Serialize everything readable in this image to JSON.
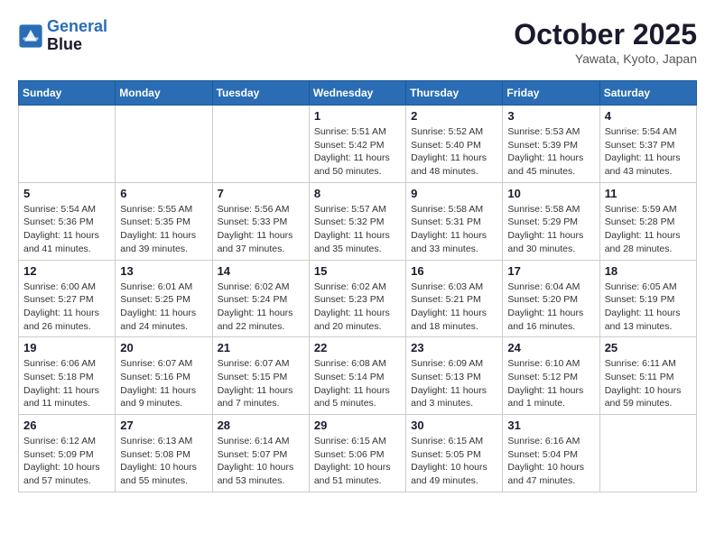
{
  "header": {
    "logo_line1": "General",
    "logo_line2": "Blue",
    "month_title": "October 2025",
    "location": "Yawata, Kyoto, Japan"
  },
  "days_of_week": [
    "Sunday",
    "Monday",
    "Tuesday",
    "Wednesday",
    "Thursday",
    "Friday",
    "Saturday"
  ],
  "weeks": [
    [
      {
        "day": "",
        "info": ""
      },
      {
        "day": "",
        "info": ""
      },
      {
        "day": "",
        "info": ""
      },
      {
        "day": "1",
        "info": "Sunrise: 5:51 AM\nSunset: 5:42 PM\nDaylight: 11 hours\nand 50 minutes."
      },
      {
        "day": "2",
        "info": "Sunrise: 5:52 AM\nSunset: 5:40 PM\nDaylight: 11 hours\nand 48 minutes."
      },
      {
        "day": "3",
        "info": "Sunrise: 5:53 AM\nSunset: 5:39 PM\nDaylight: 11 hours\nand 45 minutes."
      },
      {
        "day": "4",
        "info": "Sunrise: 5:54 AM\nSunset: 5:37 PM\nDaylight: 11 hours\nand 43 minutes."
      }
    ],
    [
      {
        "day": "5",
        "info": "Sunrise: 5:54 AM\nSunset: 5:36 PM\nDaylight: 11 hours\nand 41 minutes."
      },
      {
        "day": "6",
        "info": "Sunrise: 5:55 AM\nSunset: 5:35 PM\nDaylight: 11 hours\nand 39 minutes."
      },
      {
        "day": "7",
        "info": "Sunrise: 5:56 AM\nSunset: 5:33 PM\nDaylight: 11 hours\nand 37 minutes."
      },
      {
        "day": "8",
        "info": "Sunrise: 5:57 AM\nSunset: 5:32 PM\nDaylight: 11 hours\nand 35 minutes."
      },
      {
        "day": "9",
        "info": "Sunrise: 5:58 AM\nSunset: 5:31 PM\nDaylight: 11 hours\nand 33 minutes."
      },
      {
        "day": "10",
        "info": "Sunrise: 5:58 AM\nSunset: 5:29 PM\nDaylight: 11 hours\nand 30 minutes."
      },
      {
        "day": "11",
        "info": "Sunrise: 5:59 AM\nSunset: 5:28 PM\nDaylight: 11 hours\nand 28 minutes."
      }
    ],
    [
      {
        "day": "12",
        "info": "Sunrise: 6:00 AM\nSunset: 5:27 PM\nDaylight: 11 hours\nand 26 minutes."
      },
      {
        "day": "13",
        "info": "Sunrise: 6:01 AM\nSunset: 5:25 PM\nDaylight: 11 hours\nand 24 minutes."
      },
      {
        "day": "14",
        "info": "Sunrise: 6:02 AM\nSunset: 5:24 PM\nDaylight: 11 hours\nand 22 minutes."
      },
      {
        "day": "15",
        "info": "Sunrise: 6:02 AM\nSunset: 5:23 PM\nDaylight: 11 hours\nand 20 minutes."
      },
      {
        "day": "16",
        "info": "Sunrise: 6:03 AM\nSunset: 5:21 PM\nDaylight: 11 hours\nand 18 minutes."
      },
      {
        "day": "17",
        "info": "Sunrise: 6:04 AM\nSunset: 5:20 PM\nDaylight: 11 hours\nand 16 minutes."
      },
      {
        "day": "18",
        "info": "Sunrise: 6:05 AM\nSunset: 5:19 PM\nDaylight: 11 hours\nand 13 minutes."
      }
    ],
    [
      {
        "day": "19",
        "info": "Sunrise: 6:06 AM\nSunset: 5:18 PM\nDaylight: 11 hours\nand 11 minutes."
      },
      {
        "day": "20",
        "info": "Sunrise: 6:07 AM\nSunset: 5:16 PM\nDaylight: 11 hours\nand 9 minutes."
      },
      {
        "day": "21",
        "info": "Sunrise: 6:07 AM\nSunset: 5:15 PM\nDaylight: 11 hours\nand 7 minutes."
      },
      {
        "day": "22",
        "info": "Sunrise: 6:08 AM\nSunset: 5:14 PM\nDaylight: 11 hours\nand 5 minutes."
      },
      {
        "day": "23",
        "info": "Sunrise: 6:09 AM\nSunset: 5:13 PM\nDaylight: 11 hours\nand 3 minutes."
      },
      {
        "day": "24",
        "info": "Sunrise: 6:10 AM\nSunset: 5:12 PM\nDaylight: 11 hours\nand 1 minute."
      },
      {
        "day": "25",
        "info": "Sunrise: 6:11 AM\nSunset: 5:11 PM\nDaylight: 10 hours\nand 59 minutes."
      }
    ],
    [
      {
        "day": "26",
        "info": "Sunrise: 6:12 AM\nSunset: 5:09 PM\nDaylight: 10 hours\nand 57 minutes."
      },
      {
        "day": "27",
        "info": "Sunrise: 6:13 AM\nSunset: 5:08 PM\nDaylight: 10 hours\nand 55 minutes."
      },
      {
        "day": "28",
        "info": "Sunrise: 6:14 AM\nSunset: 5:07 PM\nDaylight: 10 hours\nand 53 minutes."
      },
      {
        "day": "29",
        "info": "Sunrise: 6:15 AM\nSunset: 5:06 PM\nDaylight: 10 hours\nand 51 minutes."
      },
      {
        "day": "30",
        "info": "Sunrise: 6:15 AM\nSunset: 5:05 PM\nDaylight: 10 hours\nand 49 minutes."
      },
      {
        "day": "31",
        "info": "Sunrise: 6:16 AM\nSunset: 5:04 PM\nDaylight: 10 hours\nand 47 minutes."
      },
      {
        "day": "",
        "info": ""
      }
    ]
  ]
}
